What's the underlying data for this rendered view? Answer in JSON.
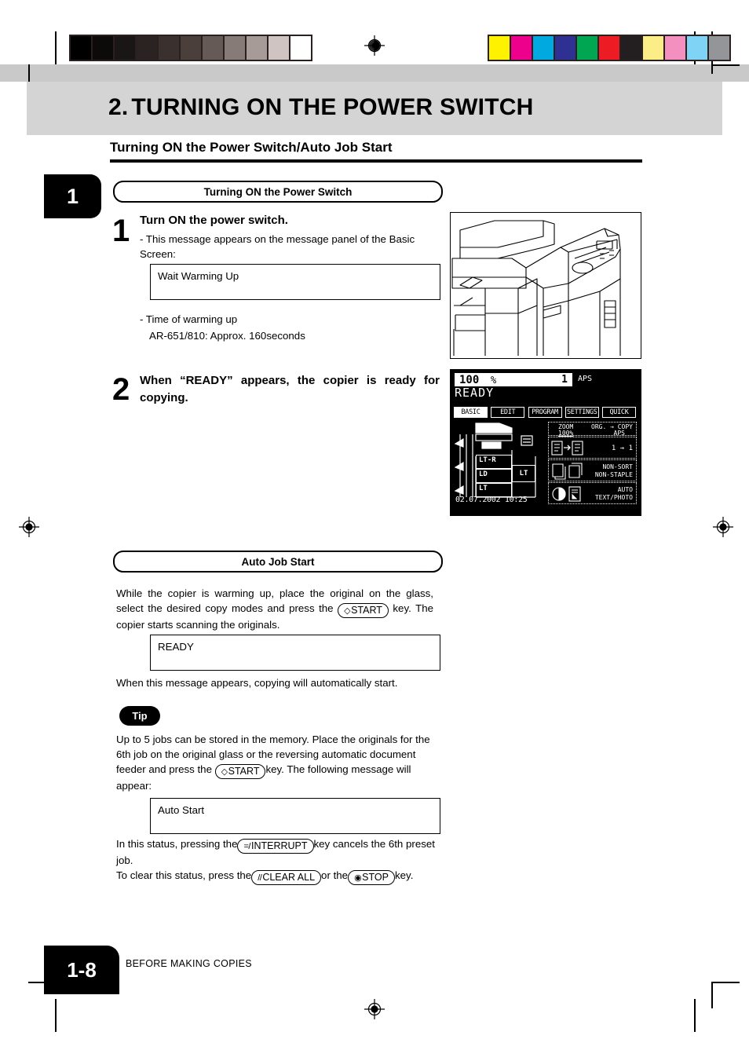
{
  "header": {
    "chapter_number": "2.",
    "chapter_title": "TURNING ON THE POWER SWITCH",
    "subtitle": "Turning ON the Power Switch/Auto Job Start",
    "chapter_tab": "1"
  },
  "section1": {
    "pill_label": "Turning ON the Power Switch",
    "step1": {
      "number": "1",
      "title": "Turn ON the power switch.",
      "bullet1": "- This message appears on the message panel of the Basic Screen:",
      "message_box": "Wait  Warming Up",
      "bullet2": "- Time of warming up",
      "bullet2_detail": "AR-651/810: Approx. 160seconds"
    },
    "step2": {
      "number": "2",
      "title": "When “READY” appears, the copier is ready for copying."
    }
  },
  "section2": {
    "pill_label": "Auto Job Start",
    "para1_a": "While the copier is warming up, place the original on the glass, select the desired copy modes and press the ",
    "para1_key": "START",
    "para1_b": " key. The copier starts scanning the originals.",
    "message_box": "READY",
    "para2": "When this message appears, copying will automatically start.",
    "tip_label": "Tip",
    "tip_a": "Up to 5 jobs can be stored in the memory. Place the originals for the 6th job on the original glass or the reversing automatic document feeder and press the ",
    "tip_key": "START",
    "tip_b": "key. The following message will appear:",
    "message_box2": "Auto Start",
    "para3_a": "In this status, pressing the",
    "para3_key": "INTERRUPT",
    "para3_b": "key cancels the 6th preset job.",
    "para4_a": "To clear this status, press the",
    "para4_key1": "CLEAR ALL",
    "para4_mid": "or the",
    "para4_key2": "STOP",
    "para4_b": "key."
  },
  "lcd": {
    "zoom_value": "100",
    "percent_sign": "%",
    "copy_count": "1",
    "paper_mode": "APS",
    "status_message": "READY",
    "tabs": [
      {
        "label": "BASIC",
        "selected": true
      },
      {
        "label": "EDIT",
        "selected": false
      },
      {
        "label": "PROGRAM",
        "selected": false
      },
      {
        "label": "SETTINGS",
        "selected": false
      },
      {
        "label": "QUICK",
        "selected": false
      }
    ],
    "zoom_label": "ZOOM",
    "zoom_ratio": "100%",
    "org_copy_label": "ORG. → COPY",
    "org_copy_value": "APS",
    "duplex_value": "1 → 1",
    "finishing_line1": "NON-SORT",
    "finishing_line2": "NON-STAPLE",
    "exposure_line1": "AUTO",
    "exposure_line2": "TEXT/PHOTO",
    "trays": [
      "LT-R",
      "LD",
      "LT"
    ],
    "tray_side": "LT",
    "datetime": "02.07.2002 10:25"
  },
  "footer": {
    "page_number": "1-8",
    "section_name": "BEFORE MAKING COPIES"
  },
  "registration": {
    "gray_wedge": [
      "#000000",
      "#0d0a0a",
      "#1b1616",
      "#2b2321",
      "#3a302d",
      "#4b3f3b",
      "#665a56",
      "#877b77",
      "#a79b98",
      "#cfc4c2",
      "#ffffff"
    ],
    "color_bar": [
      "#fff200",
      "#ec008c",
      "#00a9e0",
      "#2e3192",
      "#00a651",
      "#ed1c24",
      "#231f20",
      "#fbee86",
      "#f490c0",
      "#7fd4f5",
      "#939598"
    ]
  }
}
